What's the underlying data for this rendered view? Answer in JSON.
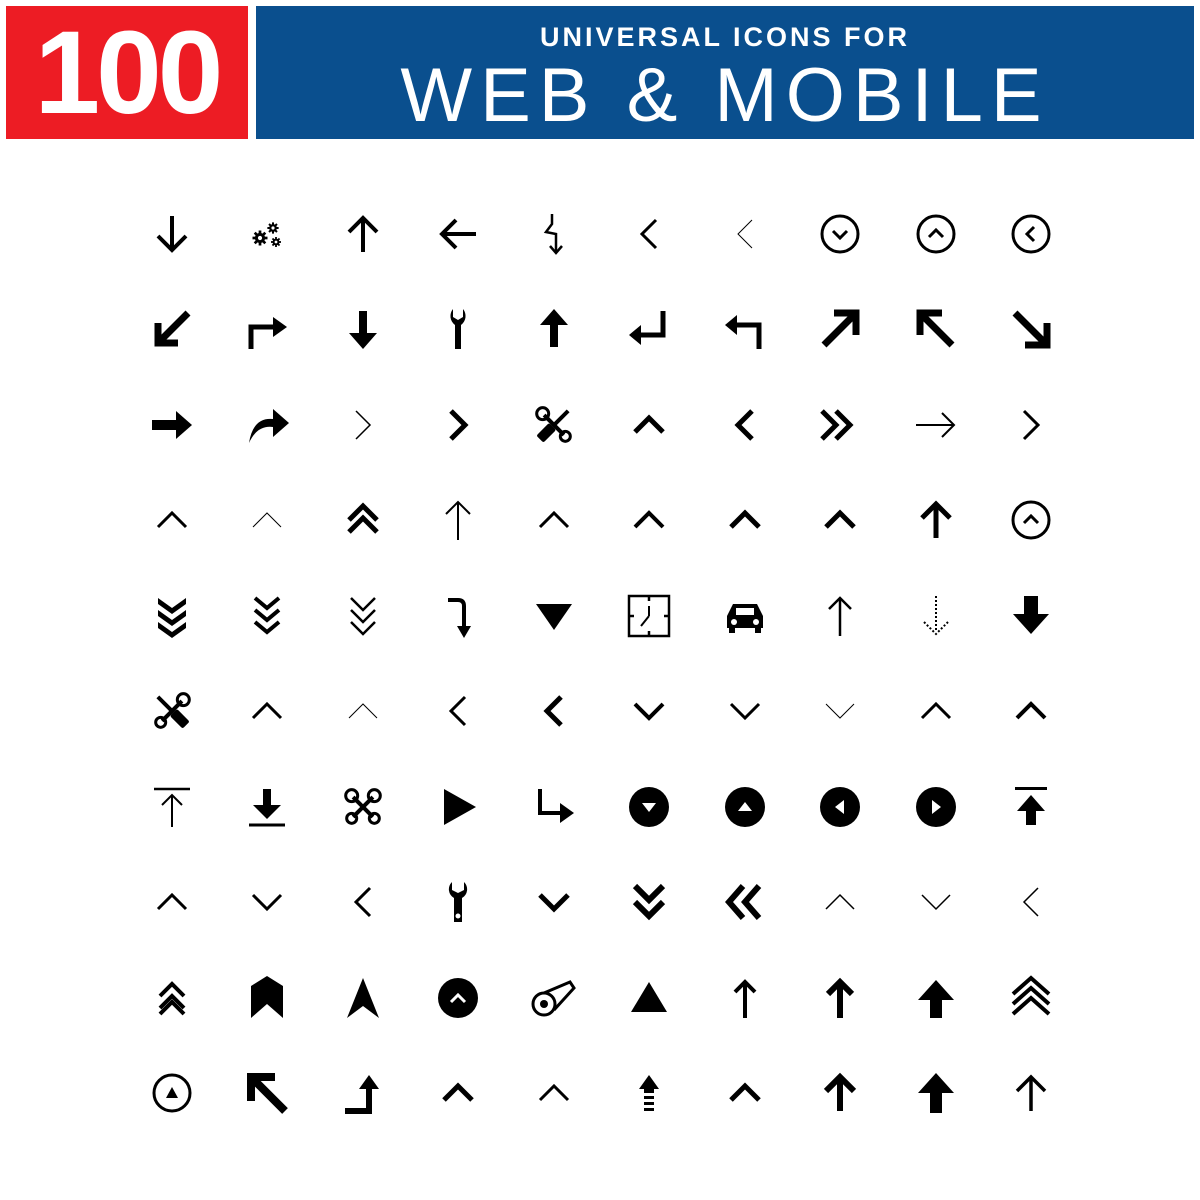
{
  "header": {
    "count": "100",
    "subtitle": "UNIVERSAL ICONS FOR",
    "title": "WEB & MOBILE"
  },
  "colors": {
    "badge": "#ed1c24",
    "banner": "#0a4f8e",
    "icon": "#000000"
  },
  "icons": [
    "arrow-down-icon",
    "gears-icon",
    "arrow-up-icon",
    "arrow-left-icon",
    "zigzag-down-arrow-icon",
    "chevron-left-icon",
    "chevron-left-thin-icon",
    "circle-chevron-down-icon",
    "circle-chevron-up-icon",
    "circle-chevron-left-icon",
    "arrow-down-left-icon",
    "turn-right-arrow-icon",
    "arrow-down-bold-icon",
    "wrench-icon",
    "arrow-up-bold-icon",
    "return-left-arrow-icon",
    "turn-left-arrow-icon",
    "arrow-up-right-icon",
    "arrow-up-left-icon",
    "arrow-down-right-icon",
    "arrow-right-bold-icon",
    "curved-forward-arrow-icon",
    "chevron-right-thin-icon",
    "chevron-right-bold-icon",
    "tools-cross-icon",
    "chevron-up-bold-icon",
    "chevron-left-bold-icon",
    "double-chevron-right-icon",
    "arrow-right-thin-icon",
    "chevron-right-icon",
    "chevron-up-icon",
    "chevron-up-thin-icon",
    "double-chevron-up-icon",
    "arrow-up-thin-icon",
    "chevron-up-icon",
    "chevron-up-icon",
    "chevron-up-bold-icon",
    "chevron-up-bold-icon",
    "arrow-up-icon",
    "circle-chevron-up-icon",
    "triple-chevron-down-filled-icon",
    "triple-chevron-down-icon",
    "triple-chevron-down-thin-icon",
    "hook-down-arrow-icon",
    "triangle-down-icon",
    "clock-icon",
    "car-icon",
    "arrow-up-thin-icon",
    "dotted-arrow-down-icon",
    "arrow-down-filled-icon",
    "screwdriver-wrench-icon",
    "chevron-up-icon",
    "chevron-up-thin-icon",
    "chevron-left-icon",
    "chevron-left-bold-icon",
    "chevron-down-bold-icon",
    "chevron-down-icon",
    "chevron-down-thin-icon",
    "chevron-up-icon",
    "chevron-up-bold-icon",
    "upload-bar-icon",
    "download-bar-icon",
    "wrench-pair-icon",
    "play-icon",
    "turn-down-right-arrow-icon",
    "circle-triangle-down-icon",
    "circle-triangle-up-icon",
    "circle-triangle-left-icon",
    "circle-triangle-right-icon",
    "upload-bar-filled-icon",
    "chevron-up-icon",
    "chevron-down-icon",
    "chevron-left-icon",
    "wrench-open-icon",
    "chevron-down-bold-icon",
    "double-chevron-down-icon",
    "double-chevron-left-icon",
    "chevron-up-thin-icon",
    "chevron-down-thin-icon",
    "chevron-left-thin-icon",
    "double-chevron-up-icon",
    "bookmark-up-icon",
    "navigation-arrow-icon",
    "circle-chevron-up-filled-icon",
    "film-reel-icon",
    "triangle-up-icon",
    "arrow-up-icon",
    "arrow-up-bold-icon",
    "arrow-up-filled-icon",
    "triple-chevron-up-icon",
    "circle-triangle-up-outline-icon",
    "arrow-up-left-bold-icon",
    "turn-up-right-arrow-icon",
    "chevron-up-bold-icon",
    "chevron-up-icon",
    "arrow-up-striped-icon",
    "chevron-up-bold-icon",
    "arrow-up-bold-icon",
    "arrow-up-filled-icon",
    "arrow-up-icon"
  ]
}
